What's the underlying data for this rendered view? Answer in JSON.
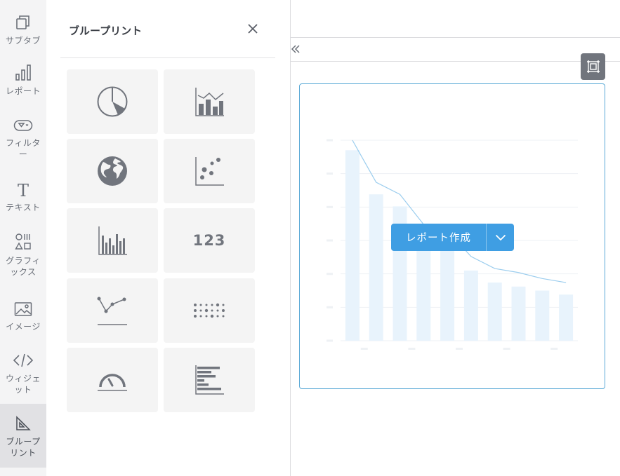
{
  "toolbar": {
    "items": [
      {
        "label": "サブタブ",
        "icon": "subtab-icon"
      },
      {
        "label": "レポート",
        "icon": "bar-chart-icon"
      },
      {
        "label": "フィルター",
        "icon": "filter-icon"
      },
      {
        "label": "テキスト",
        "icon": "text-icon"
      },
      {
        "label": "グラフィックス",
        "icon": "graphics-icon"
      },
      {
        "label": "イメージ",
        "icon": "image-icon"
      },
      {
        "label": "ウィジェット",
        "icon": "code-icon"
      },
      {
        "label": "ブループリント",
        "icon": "blueprint-icon",
        "active": true
      }
    ]
  },
  "panel": {
    "title": "ブループリント",
    "tiles": [
      {
        "icon": "pie-chart-icon"
      },
      {
        "icon": "bar-line-combo-icon"
      },
      {
        "icon": "globe-map-icon"
      },
      {
        "icon": "scatter-plot-icon"
      },
      {
        "icon": "column-chart-icon"
      },
      {
        "icon": "number-icon",
        "text": "123"
      },
      {
        "icon": "line-chart-icon"
      },
      {
        "icon": "dot-matrix-icon"
      },
      {
        "icon": "gauge-icon"
      },
      {
        "icon": "horizontal-bar-icon"
      }
    ]
  },
  "widget": {
    "create_label": "レポート作成"
  },
  "colors": {
    "accent": "#3f9ee3",
    "widget_border": "#5aa9d6",
    "placeholder_bar": "#e8f3fc",
    "placeholder_line": "#9bcdee",
    "icon": "#71757d"
  },
  "chart_data": {
    "type": "bar",
    "categories": [
      "",
      "",
      "",
      "",
      "",
      "",
      "",
      "",
      "",
      ""
    ],
    "series": [
      {
        "type": "bar",
        "values": [
          95,
          73,
          67,
          55,
          52,
          35,
          29,
          27,
          25,
          23
        ]
      },
      {
        "type": "line",
        "values": [
          100,
          79,
          73,
          58,
          55,
          42,
          36,
          34,
          31,
          29
        ]
      }
    ],
    "ylim": [
      0,
      100
    ],
    "grid": true
  }
}
